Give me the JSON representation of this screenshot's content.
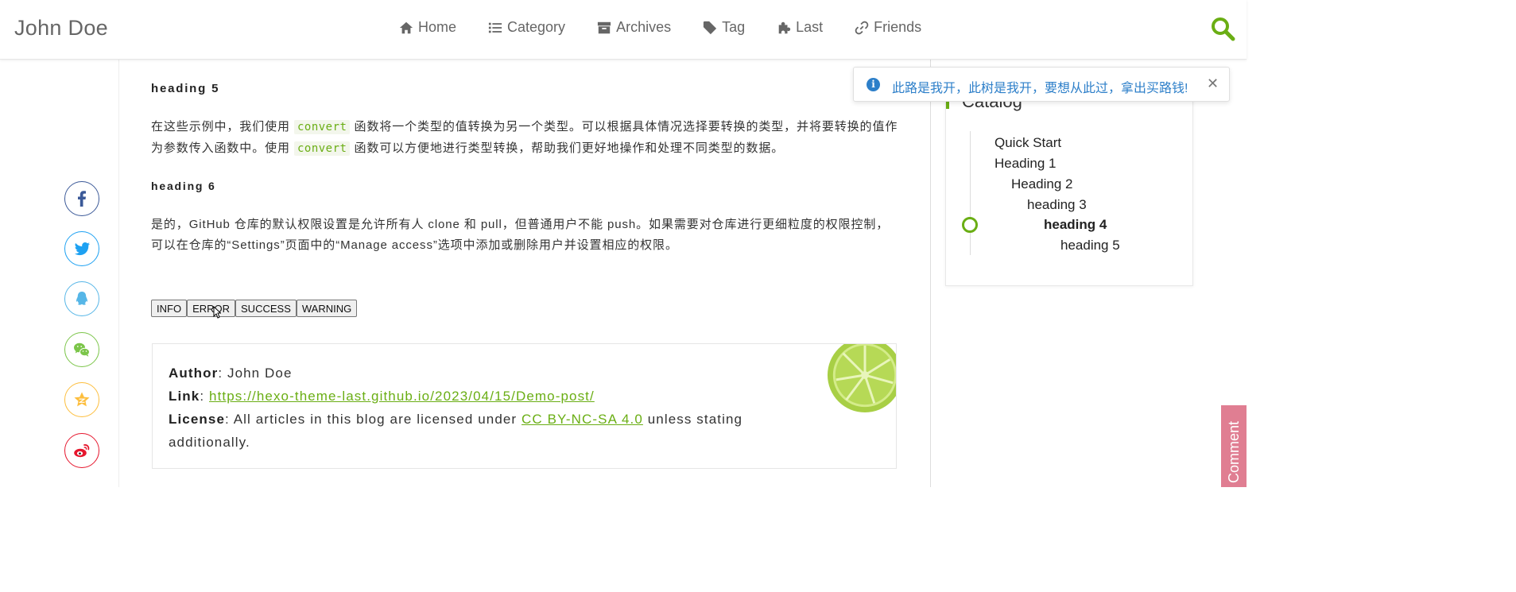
{
  "header": {
    "site_title": "John Doe",
    "nav": [
      {
        "label": "Home",
        "icon": "home-icon"
      },
      {
        "label": "Category",
        "icon": "list-icon"
      },
      {
        "label": "Archives",
        "icon": "archive-icon"
      },
      {
        "label": "Tag",
        "icon": "tag-icon"
      },
      {
        "label": "Last",
        "icon": "puzzle-icon"
      },
      {
        "label": "Friends",
        "icon": "link-icon"
      }
    ],
    "search_icon": "search-icon"
  },
  "share": [
    {
      "name": "facebook",
      "color": "#3b5998"
    },
    {
      "name": "twitter",
      "color": "#1da1f2"
    },
    {
      "name": "qq",
      "color": "#56b6e7"
    },
    {
      "name": "wechat",
      "color": "#7bc549"
    },
    {
      "name": "qzone",
      "color": "#fdbe3d"
    },
    {
      "name": "weibo",
      "color": "#e6162d"
    }
  ],
  "article": {
    "h5": "heading 5",
    "p1a": "在这些示例中，我们使用 ",
    "code1": "convert",
    "p1b": " 函数将一个类型的值转换为另一个类型。可以根据具体情况选择要转换的类型，并将要转换的值作为参数传入函数中。使用 ",
    "code2": "convert",
    "p1c": " 函数可以方便地进行类型转换，帮助我们更好地操作和处理不同类型的数据。",
    "h6": "heading 6",
    "p2": "是的，GitHub 仓库的默认权限设置是允许所有人 clone 和 pull，但普通用户不能 push。如果需要对仓库进行更细粒度的权限控制，可以在仓库的“Settings”页面中的“Manage access”选项中添加或删除用户并设置相应的权限。"
  },
  "buttons": {
    "info": "INFO",
    "error": "ERROR",
    "success": "SUCCESS",
    "warning": "WARNING"
  },
  "copyright": {
    "author_label": "Author",
    "author": "John Doe",
    "link_label": "Link",
    "link": "https://hexo-theme-last.github.io/2023/04/15/Demo-post/",
    "license_label": "License",
    "license_pre": "All articles in this blog are licensed under ",
    "license_link": "CC BY-NC-SA 4.0",
    "license_post": " unless stating additionally."
  },
  "catalog": {
    "title": "Catalog",
    "items": [
      {
        "label": "Quick Start",
        "active": false
      },
      {
        "label": "Heading 1",
        "active": false
      },
      {
        "label": "Heading 2",
        "active": false
      },
      {
        "label": "heading 3",
        "active": false
      },
      {
        "label": "heading 4",
        "active": true
      },
      {
        "label": "heading 5",
        "active": false
      }
    ]
  },
  "toast": {
    "text": "此路是我开，此树是我开，要想从此过，拿出买路钱!",
    "icon": "info-icon",
    "close": "✕"
  },
  "comment_tab": "Comment",
  "colors": {
    "accent": "#6aae14",
    "toast_blue": "#2d7fc9",
    "comment_pink": "#e07e92"
  }
}
